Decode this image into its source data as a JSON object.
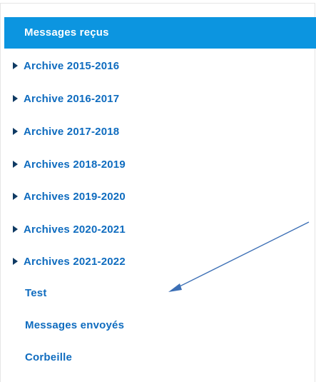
{
  "sidebar": {
    "active_item": {
      "label": "Messages reçus"
    },
    "items": [
      {
        "label": "Archive 2015-2016",
        "icon": "caret-right-icon"
      },
      {
        "label": "Archive 2016-2017",
        "icon": "caret-right-icon"
      },
      {
        "label": "Archive 2017-2018",
        "icon": "caret-right-icon"
      },
      {
        "label": "Archives 2018-2019",
        "icon": "caret-right-icon"
      },
      {
        "label": "Archives 2019-2020",
        "icon": "caret-right-icon"
      },
      {
        "label": "Archives 2020-2021",
        "icon": "caret-right-icon"
      },
      {
        "label": "Archives 2021-2022",
        "icon": "caret-right-icon"
      },
      {
        "label": "Test"
      },
      {
        "label": "Messages envoyés"
      },
      {
        "label": "Corbeille"
      }
    ]
  },
  "colors": {
    "active_background": "#0c95e0",
    "link_text": "#0f6cbf",
    "caret": "#0f3a63",
    "annotation_arrow": "#3c6fb5"
  }
}
